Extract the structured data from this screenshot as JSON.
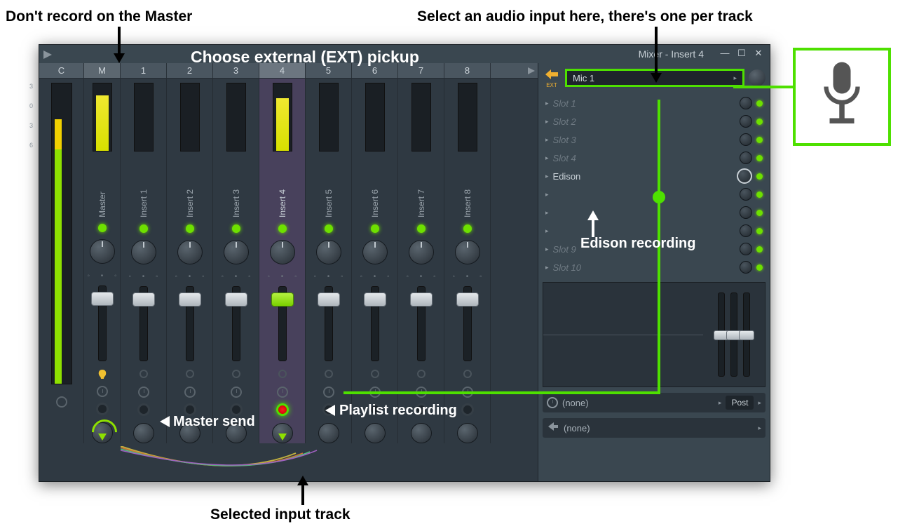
{
  "annotations": {
    "dont_record": "Don't record on the Master",
    "select_input": "Select an audio input here, there's one per track",
    "choose_ext": "Choose external (EXT) pickup",
    "master_send": "Master send",
    "playlist_rec": "Playlist recording",
    "edison_rec": "Edison recording",
    "selected_track": "Selected input track"
  },
  "window": {
    "title": "Mixer - Insert 4"
  },
  "headers": {
    "c": "C",
    "m": "M",
    "nums": [
      "1",
      "2",
      "3",
      "4",
      "5",
      "6",
      "7",
      "8"
    ]
  },
  "tracks": {
    "master": "Master",
    "inserts": [
      "Insert 1",
      "Insert 2",
      "Insert 3",
      "Insert 4",
      "Insert 5",
      "Insert 6",
      "Insert 7",
      "Insert 8"
    ]
  },
  "meter_scale": [
    "3",
    "0",
    "3",
    "6"
  ],
  "input": {
    "ext_label": "EXT",
    "selected": "Mic 1"
  },
  "slots": [
    {
      "name": "Slot 1",
      "active": false,
      "big": false
    },
    {
      "name": "Slot 2",
      "active": false,
      "big": false
    },
    {
      "name": "Slot 3",
      "active": false,
      "big": false
    },
    {
      "name": "Slot 4",
      "active": false,
      "big": false
    },
    {
      "name": "Edison",
      "active": true,
      "big": true
    },
    {
      "name": "",
      "active": false,
      "big": false
    },
    {
      "name": "",
      "active": false,
      "big": false
    },
    {
      "name": "",
      "active": false,
      "big": false
    },
    {
      "name": "Slot 9",
      "active": false,
      "big": false
    },
    {
      "name": "Slot 10",
      "active": false,
      "big": false
    }
  ],
  "output": {
    "time_none": "(none)",
    "post": "Post",
    "out_none": "(none)"
  }
}
